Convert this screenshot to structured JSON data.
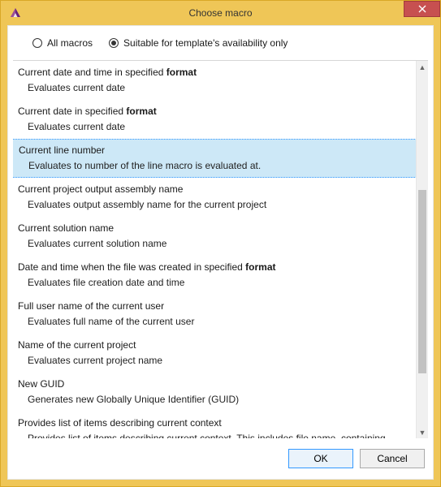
{
  "window": {
    "title": "Choose macro"
  },
  "filter": {
    "all_label": "All macros",
    "suitable_label": "Suitable for template's availability only",
    "selected": "suitable"
  },
  "list": {
    "items": [
      {
        "title_pre": "Current date and time in specified ",
        "title_bold": "format",
        "desc": "Evaluates current date"
      },
      {
        "title_pre": "Current date in specified ",
        "title_bold": "format",
        "desc": "Evaluates current date"
      },
      {
        "title_pre": "Current line number",
        "title_bold": "",
        "desc": "Evaluates to number of the line macro is evaluated at.",
        "selected": true
      },
      {
        "title_pre": "Current project output assembly name",
        "title_bold": "",
        "desc": "Evaluates output assembly name for the current project"
      },
      {
        "title_pre": "Current solution name",
        "title_bold": "",
        "desc": "Evaluates current solution name"
      },
      {
        "title_pre": "Date and time when the file was created in specified ",
        "title_bold": "format",
        "desc": "Evaluates file creation date and time"
      },
      {
        "title_pre": "Full user name of the current user",
        "title_bold": "",
        "desc": "Evaluates full name of the current user"
      },
      {
        "title_pre": "Name of the current project",
        "title_bold": "",
        "desc": "Evaluates current project name"
      },
      {
        "title_pre": "New GUID",
        "title_bold": "",
        "desc": "Generates new Globally Unique Identifier (GUID)"
      },
      {
        "title_pre": "Provides list of items describing current context",
        "title_bold": "",
        "desc": "Provides list of items describing current context. This includes file name, containing"
      }
    ]
  },
  "buttons": {
    "ok": "OK",
    "cancel": "Cancel"
  },
  "scrollbar": {
    "thumb_top_pct": 33,
    "thumb_height_pct": 52
  }
}
